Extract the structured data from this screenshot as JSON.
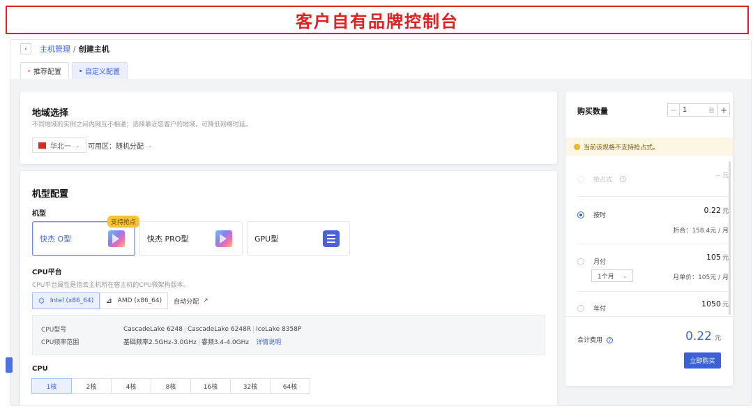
{
  "banner": {
    "title": "客户自有品牌控制台"
  },
  "breadcrumb": {
    "back_icon": "chevron-left-icon",
    "parent": "主机管理",
    "separator": "/",
    "current": "创建主机"
  },
  "tabs": [
    {
      "label": "推荐配置",
      "active": false
    },
    {
      "label": "自定义配置",
      "active": true
    }
  ],
  "region": {
    "title": "地域选择",
    "desc": "不同地域的实例之间内网互不相通；选择靠近您客户的地域，可降低网络时延。",
    "selected_region": "华北一",
    "zone_label": "可用区：随机分配"
  },
  "machine": {
    "title": "机型配置",
    "type_label": "机型",
    "types": [
      {
        "label": "快杰 O型",
        "icon": "prism-icon",
        "selected": true,
        "badge": "支持抢点"
      },
      {
        "label": "快杰 PRO型",
        "icon": "prism-icon",
        "selected": false
      },
      {
        "label": "GPU型",
        "icon": "gpu-list-icon",
        "selected": false
      }
    ],
    "cpu_platform_label": "CPU平台",
    "cpu_platform_desc": "CPU平台属性是指云主机所在宿主机的CPU微架构版本。",
    "arch_options": [
      {
        "label": "Intel (x86_64)",
        "selected": true
      },
      {
        "label": "AMD (x86_64)",
        "selected": false
      }
    ],
    "auto_assign": "自动分配",
    "cpu_model_key": "CPU型号",
    "cpu_models": [
      "CascadeLake 6248",
      "CascadeLake 6248R",
      "IceLake 8358P"
    ],
    "cpu_freq_key": "CPU频率范围",
    "cpu_base_freq": "基础频率2.5GHz-3.0GHz",
    "cpu_turbo_freq": "睿频3.4-4.0GHz",
    "detail_link": "详情说明",
    "cpu_label": "CPU",
    "cores": [
      "1核",
      "2核",
      "4核",
      "8核",
      "16核",
      "32核",
      "64核"
    ],
    "selected_core": "1核"
  },
  "purchase": {
    "qty_title": "购买数量",
    "qty_value": "1",
    "qty_unit": "台",
    "minus": "−",
    "plus": "+",
    "warning": "当前该规格不支持抢占式。",
    "options": [
      {
        "name": "抢占式",
        "price": "-- 元",
        "disabled": true
      },
      {
        "name": "按时",
        "price": "0.22",
        "unit": "元",
        "sub": "折合：158.4元 / 月",
        "selected": true
      },
      {
        "name": "月付",
        "price": "105",
        "unit": "元",
        "select_value": "1个月",
        "sub": "月单价：105元 / 月"
      },
      {
        "name": "年付",
        "price": "1050",
        "unit": "元"
      }
    ],
    "total_label": "合计费用",
    "total_price": "0.22",
    "total_unit": "元",
    "buy_label": "立即购买"
  },
  "colors": {
    "brand": "#3a62d6",
    "banner_red": "#e02020",
    "badge": "#f7c437"
  }
}
